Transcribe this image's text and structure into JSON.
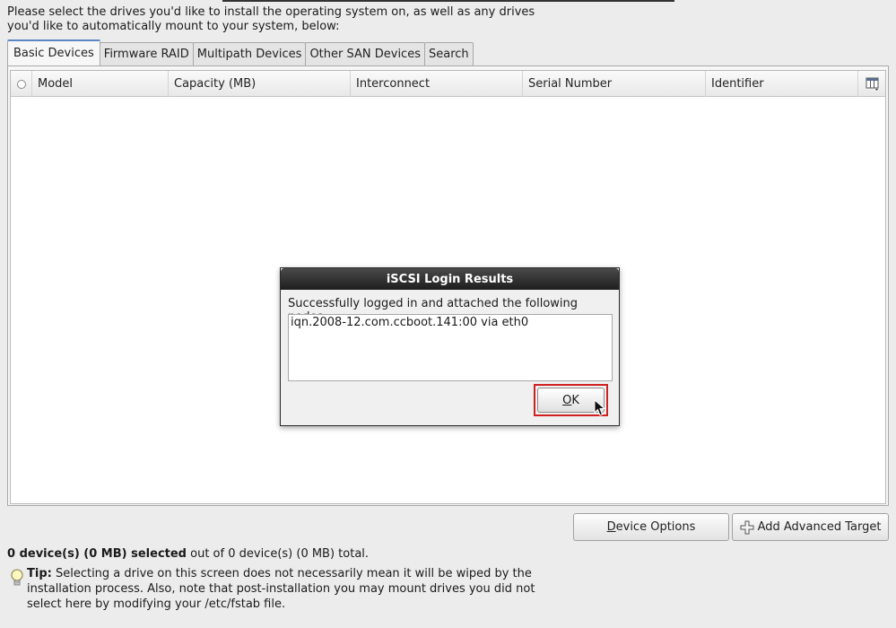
{
  "intro": {
    "line1": "Please select the drives you'd like to install the operating system on, as well as any drives",
    "line2": "you'd like to automatically mount to your system, below:"
  },
  "tabs": [
    {
      "label": "Basic Devices",
      "active": true
    },
    {
      "label": "Firmware RAID",
      "active": false
    },
    {
      "label": "Multipath Devices",
      "active": false
    },
    {
      "label": "Other SAN Devices",
      "active": false
    },
    {
      "label": "Search",
      "active": false
    }
  ],
  "table": {
    "columns": [
      "Model",
      "Capacity (MB)",
      "Interconnect",
      "Serial Number",
      "Identifier"
    ],
    "rows": []
  },
  "buttons": {
    "device_options_mnemonic": "D",
    "device_options_rest": "evice Options",
    "add_target": "Add Advanced Target"
  },
  "summary": {
    "selected": "0 device(s) (0 MB) selected",
    "rest": " out of 0 device(s) (0 MB) total."
  },
  "tip": {
    "label": "Tip:",
    "line1": " Selecting a drive on this screen does not necessarily mean it will be wiped by the",
    "line2": "installation process.  Also, note that post-installation you may mount drives you did not",
    "line3": "select here by modifying your /etc/fstab file."
  },
  "dialog": {
    "title": "iSCSI Login Results",
    "message": "Successfully logged in and attached the following nodes:",
    "nodes": [
      "iqn.2008-12.com.ccboot.141:00 via eth0"
    ],
    "ok_mnemonic": "O",
    "ok_rest": "K"
  },
  "colors": {
    "highlight": "#d02020",
    "tab_accent": "#5b87c4"
  }
}
